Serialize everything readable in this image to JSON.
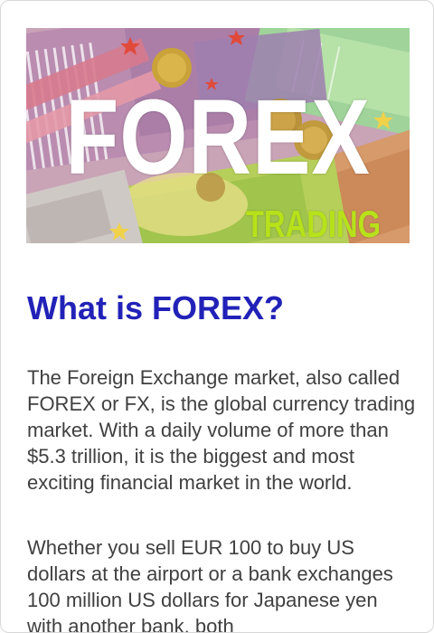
{
  "hero": {
    "title": "FOREX",
    "subtitle": "TRADING",
    "image_icon": "currency-banknotes-image",
    "colors": {
      "title": "#ffffff",
      "subtitle": "#b7e21a"
    }
  },
  "article": {
    "heading": "What is FOREX?",
    "paragraphs": [
      "The Foreign Exchange market, also called FOREX or FX, is the global currency trading market. With a daily volume of more than $5.3 trillion, it is the biggest and most exciting financial market in the world.",
      "Whether you sell EUR 100 to buy US dollars at the airport or a bank exchanges 100 million US dollars for Japanese yen with another bank, both"
    ]
  },
  "colors": {
    "heading": "#2222b8",
    "body_text": "#404040"
  }
}
